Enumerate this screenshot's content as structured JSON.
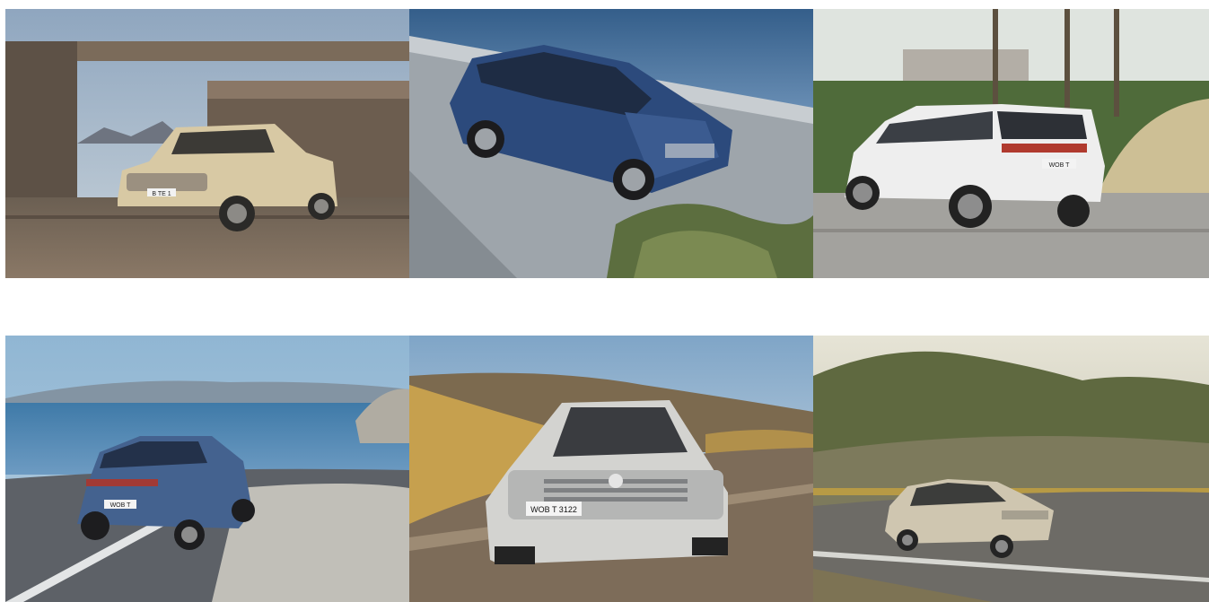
{
  "gallery": {
    "images": [
      {
        "plate": "B TE 1"
      },
      {
        "plate": ""
      },
      {
        "plate": "WOB T"
      },
      {
        "plate": "WOB T"
      },
      {
        "plate": "WOB T 3122"
      },
      {
        "plate": ""
      }
    ]
  },
  "colors": {
    "background": "#ffffff",
    "car_champagne": "#d8c9a4",
    "car_blue": "#2c4a7c",
    "car_white": "#eeeeee",
    "car_steel_blue": "#44628f",
    "car_silver": "#d3d3d0",
    "car_sand": "#cfc6b0"
  }
}
